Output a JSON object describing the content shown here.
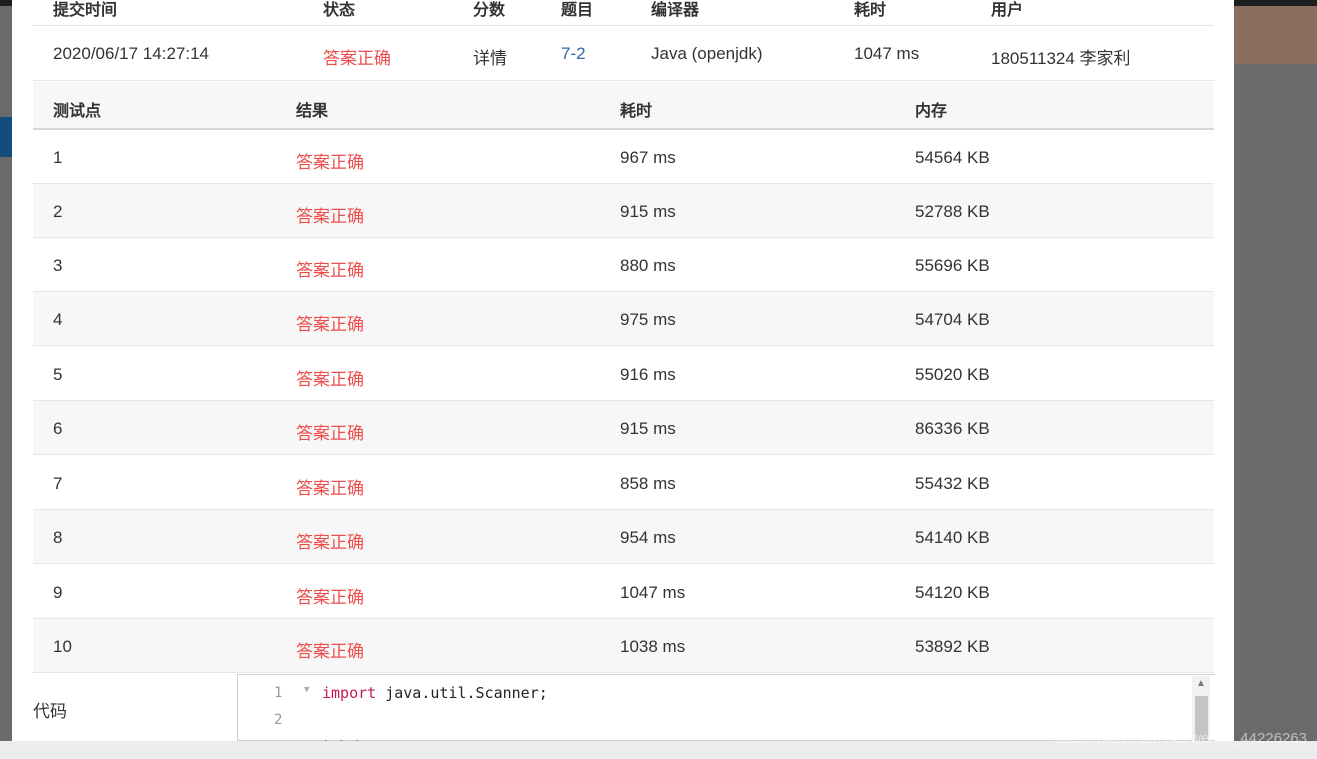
{
  "submission": {
    "headers": [
      "提交时间",
      "状态",
      "分数",
      "题目",
      "编译器",
      "耗时",
      "用户"
    ],
    "time": "2020/06/17 14:27:14",
    "status": "答案正确",
    "score": "详情",
    "problem": "7-2",
    "compiler": "Java (openjdk)",
    "elapsed": "1047 ms",
    "user": "180511324 李家利"
  },
  "testcases": {
    "headers": [
      "测试点",
      "结果",
      "耗时",
      "内存"
    ],
    "rows": [
      {
        "id": "1",
        "result": "答案正确",
        "time": "967 ms",
        "memory": "54564 KB"
      },
      {
        "id": "2",
        "result": "答案正确",
        "time": "915 ms",
        "memory": "52788 KB"
      },
      {
        "id": "3",
        "result": "答案正确",
        "time": "880 ms",
        "memory": "55696 KB"
      },
      {
        "id": "4",
        "result": "答案正确",
        "time": "975 ms",
        "memory": "54704 KB"
      },
      {
        "id": "5",
        "result": "答案正确",
        "time": "916 ms",
        "memory": "55020 KB"
      },
      {
        "id": "6",
        "result": "答案正确",
        "time": "915 ms",
        "memory": "86336 KB"
      },
      {
        "id": "7",
        "result": "答案正确",
        "time": "858 ms",
        "memory": "55432 KB"
      },
      {
        "id": "8",
        "result": "答案正确",
        "time": "954 ms",
        "memory": "54140 KB"
      },
      {
        "id": "9",
        "result": "答案正确",
        "time": "1047 ms",
        "memory": "54120 KB"
      },
      {
        "id": "10",
        "result": "答案正确",
        "time": "1038 ms",
        "memory": "53892 KB"
      }
    ]
  },
  "code": {
    "label": "代码",
    "line_numbers": [
      "1",
      "2"
    ],
    "line1_keyword": "import",
    "line1_rest": " java.util.Scanner;",
    "line3_partial": "· · ·"
  },
  "watermark": "https://blog.csdn.net/weixin_44226263",
  "colors": {
    "status_red": "#ef4d4d",
    "link_blue": "#2b6aa5",
    "keyword": "#c41c4c",
    "overlay": "#6b6b6b"
  }
}
